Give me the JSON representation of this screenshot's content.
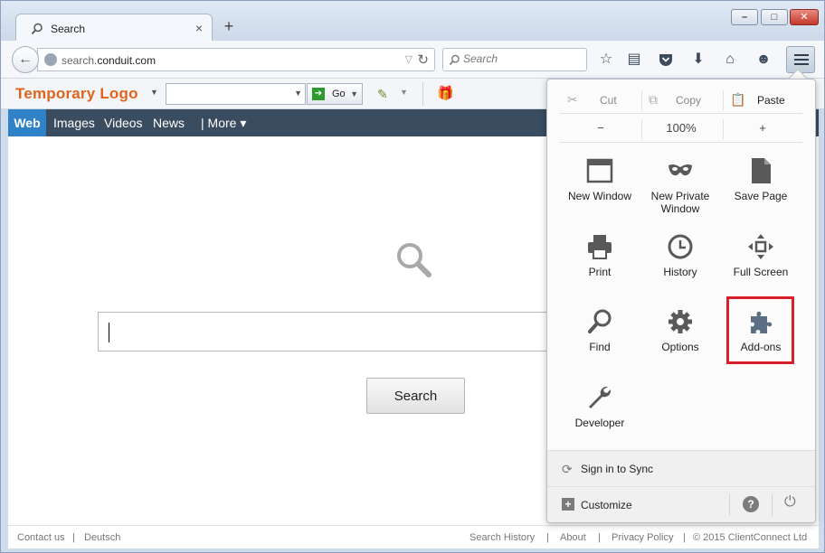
{
  "browser": {
    "tab_title": "Search",
    "url_prefix": "search.",
    "url_domain": "conduit.com",
    "search_placeholder": "Search",
    "new_tab_label": "+",
    "close_tab_label": "×"
  },
  "conduit_toolbar": {
    "logo": "Temporary Logo",
    "go_label": "Go"
  },
  "search_nav": {
    "items": [
      "Web",
      "Images",
      "Videos",
      "News",
      "| More ▾"
    ]
  },
  "main": {
    "search_button": "Search"
  },
  "footer": {
    "left": [
      "Contact us",
      "|",
      "Deutsch"
    ],
    "right": [
      "Search History",
      "|",
      "About",
      "|",
      "Privacy Policy",
      "|",
      "© 2015 ClientConnect Ltd"
    ]
  },
  "menu_panel": {
    "edit": {
      "cut": "Cut",
      "copy": "Copy",
      "paste": "Paste"
    },
    "zoom": {
      "minus": "−",
      "level": "100%",
      "plus": "+"
    },
    "tiles": [
      {
        "label": "New Window",
        "icon": "new-window-icon"
      },
      {
        "label": "New Private Window",
        "icon": "private-mask-icon"
      },
      {
        "label": "Save Page",
        "icon": "save-page-icon"
      },
      {
        "label": "Print",
        "icon": "printer-icon"
      },
      {
        "label": "History",
        "icon": "clock-icon"
      },
      {
        "label": "Full Screen",
        "icon": "fullscreen-icon"
      },
      {
        "label": "Find",
        "icon": "magnifier-icon"
      },
      {
        "label": "Options",
        "icon": "gear-icon"
      },
      {
        "label": "Add-ons",
        "icon": "puzzle-icon"
      },
      {
        "label": "Developer",
        "icon": "wrench-icon"
      }
    ],
    "sync_label": "Sign in to Sync",
    "customize_label": "Customize",
    "help_label": "?"
  },
  "colors": {
    "accent_blue": "#2f82c7",
    "nav_dark": "#3a4c60",
    "logo_orange": "#e0641c",
    "highlight_red": "#d9202a"
  }
}
